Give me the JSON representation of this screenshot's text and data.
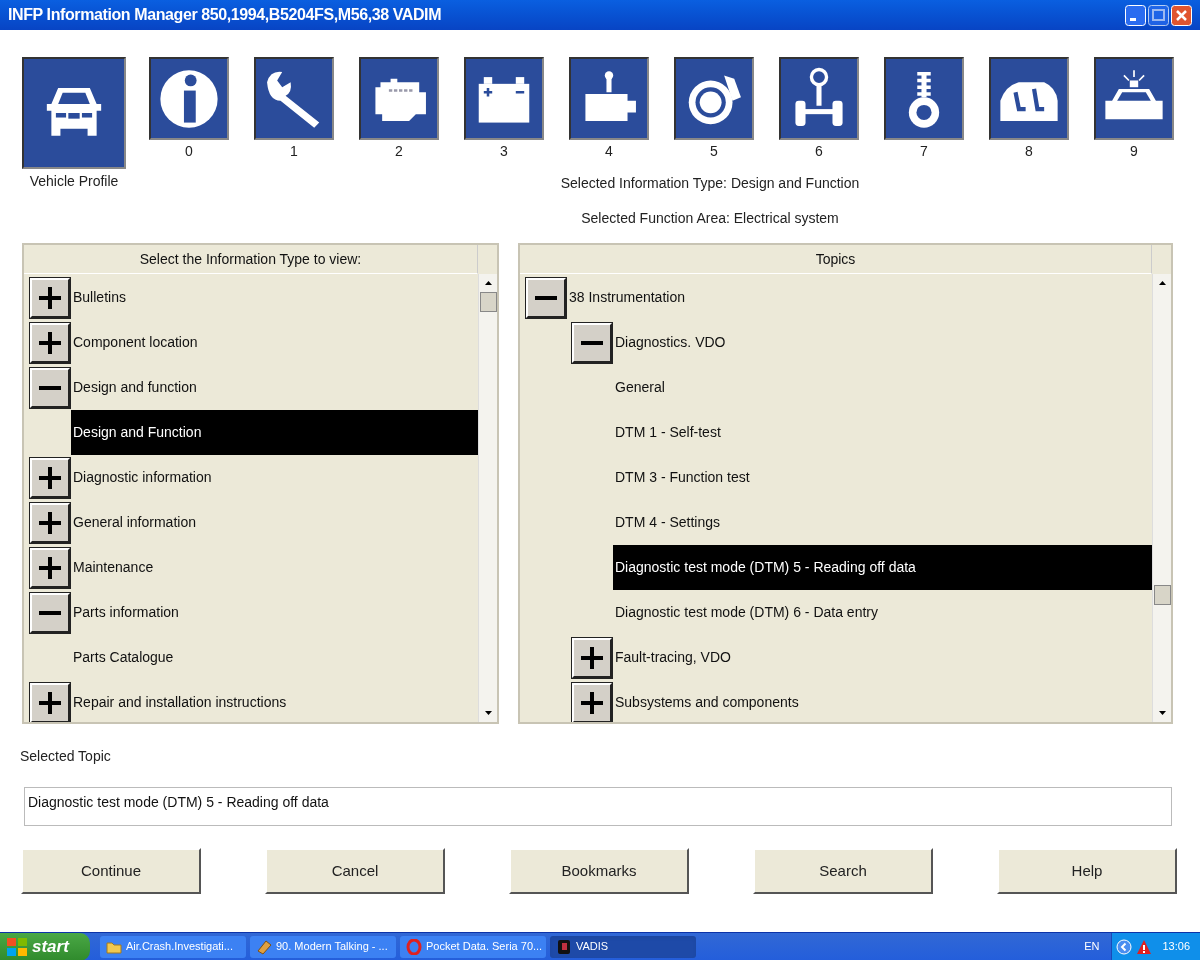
{
  "window": {
    "title": "INFP Information Manager 850,1994,B5204FS,M56,38 VADIM"
  },
  "profile": {
    "label": "Vehicle Profile"
  },
  "function_groups": [
    {
      "label": "0"
    },
    {
      "label": "1"
    },
    {
      "label": "2"
    },
    {
      "label": "3"
    },
    {
      "label": "4"
    },
    {
      "label": "5"
    },
    {
      "label": "6"
    },
    {
      "label": "7"
    },
    {
      "label": "8"
    },
    {
      "label": "9"
    }
  ],
  "selected_information_type": "Selected Information Type: Design and Function",
  "selected_function_area": "Selected Function Area: Electrical system",
  "information_panel": {
    "header": "Select the Information Type to view:",
    "items": [
      {
        "label": "Bulletins",
        "kind": "node",
        "expanded": false,
        "selected": false
      },
      {
        "label": "Component location",
        "kind": "node",
        "expanded": false,
        "selected": false
      },
      {
        "label": "Design and function",
        "kind": "node",
        "expanded": true,
        "selected": false,
        "children": [
          {
            "label": "Design and Function",
            "kind": "leaf",
            "selected": true
          }
        ]
      },
      {
        "label": "Diagnostic information",
        "kind": "node",
        "expanded": false,
        "selected": false
      },
      {
        "label": "General information",
        "kind": "node",
        "expanded": false,
        "selected": false
      },
      {
        "label": "Maintenance",
        "kind": "node",
        "expanded": false,
        "selected": false
      },
      {
        "label": "Parts information",
        "kind": "node",
        "expanded": true,
        "selected": false,
        "children": [
          {
            "label": "Parts Catalogue",
            "kind": "leaf",
            "selected": false
          }
        ]
      },
      {
        "label": "Repair and installation instructions",
        "kind": "node",
        "expanded": false,
        "selected": false
      }
    ]
  },
  "topics_panel": {
    "header": "Topics",
    "items": [
      {
        "label": "38 Instrumentation",
        "kind": "node",
        "expanded": true,
        "selected": false,
        "children": [
          {
            "label": "Diagnostics. VDO",
            "kind": "node",
            "expanded": true,
            "selected": false,
            "children": [
              {
                "label": "General",
                "kind": "leaf",
                "selected": false
              },
              {
                "label": "DTM 1 - Self-test",
                "kind": "leaf",
                "selected": false
              },
              {
                "label": "DTM 3 - Function test",
                "kind": "leaf",
                "selected": false
              },
              {
                "label": "DTM 4 - Settings",
                "kind": "leaf",
                "selected": false
              },
              {
                "label": "Diagnostic test mode (DTM) 5 - Reading off data",
                "kind": "leaf",
                "selected": true
              },
              {
                "label": "Diagnostic test mode (DTM) 6 - Data entry",
                "kind": "leaf",
                "selected": false
              }
            ]
          },
          {
            "label": "Fault-tracing, VDO",
            "kind": "node",
            "expanded": false,
            "selected": false
          },
          {
            "label": "Subsystems and components",
            "kind": "node",
            "expanded": false,
            "selected": false
          }
        ]
      }
    ]
  },
  "selected_topic": {
    "label": "Selected Topic",
    "value": "Diagnostic test mode (DTM) 5 - Reading off data"
  },
  "buttons": [
    "Continue",
    "Cancel",
    "Bookmarks",
    "Search",
    "Help"
  ],
  "taskbar": {
    "start": "start",
    "tasks": [
      {
        "label": "Air.Crash.Investigati...",
        "selected": false
      },
      {
        "label": "90. Modern Talking - ...",
        "selected": false
      },
      {
        "label": "Pocket Data. Seria 70...",
        "selected": false
      },
      {
        "label": "VADIS",
        "selected": true
      }
    ],
    "language": "EN",
    "clock": "13:06"
  }
}
